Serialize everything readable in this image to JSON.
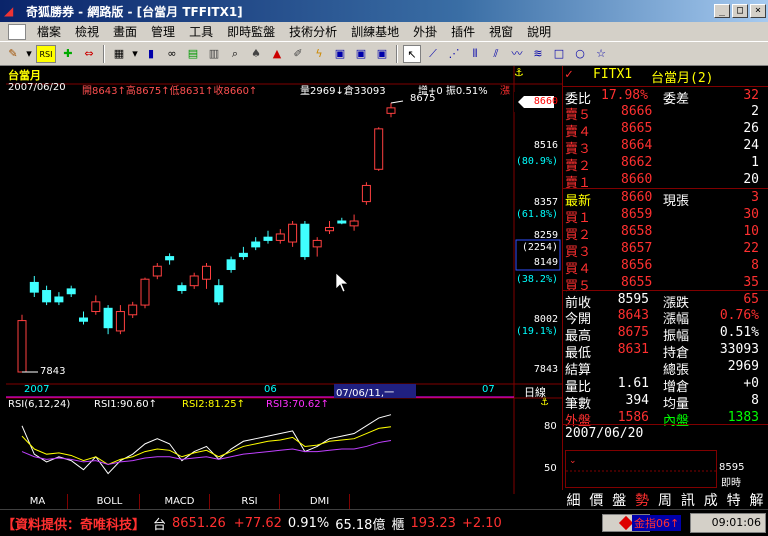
{
  "window": {
    "title": "奇狐勝券 - 網路版 - [台當月 TFFITX1]",
    "min": "_",
    "max": "□",
    "close": "×"
  },
  "menu": [
    "檔案",
    "檢視",
    "畫面",
    "管理",
    "工具",
    "即時監盤",
    "技術分析",
    "訓練基地",
    "外掛",
    "插件",
    "視窗",
    "說明"
  ],
  "toolbar": {
    "rsi_label": "RSI",
    "icons": [
      "arrow-icon",
      "cross-icon",
      "swap-icon",
      "grid-icon",
      "bar-icon",
      "link-icon",
      "book-icon",
      "search-icon",
      "hat-icon",
      "alarm-icon",
      "pen-icon",
      "flash-icon",
      "window-icon",
      "window2-icon",
      "window3-icon",
      "cursor-icon",
      "line-icon",
      "fan-icon",
      "lines-icon",
      "wave-icon",
      "wave2-icon",
      "box-icon",
      "circle-icon",
      "star-icon"
    ]
  },
  "chart": {
    "name": "台當月",
    "date": "2007/06/20",
    "ohlc": "開8643↑高8675↑低8631↑收8660↑",
    "vol": "量2969↓倉33093",
    "inc": "增+0 振0.51%",
    "rise": "漲",
    "high_label": "8675",
    "low_label": "7843",
    "price_scale": [
      "8660",
      "8516",
      "(80.9%)",
      "8357",
      "(61.8%)",
      "8259",
      "(2254)",
      "8149",
      "(38.2%)",
      "8002",
      "(19.1%)",
      "7843"
    ],
    "price_scale_colors": {
      "sel": "#ff0000",
      "fib": "#00ffff",
      "norm": "#ffffff",
      "blue": "#3050ff"
    },
    "xaxis": {
      "y2007": "2007",
      "m06": "06",
      "cursor": "07/06/11,一",
      "m07": "07",
      "daily": "日線"
    },
    "rsi_title": "RSI(6,12,24)",
    "rsi1": "RSI1:90.60↑",
    "rsi2": "RSI2:81.25↑",
    "rsi3": "RSI3:70.62↑",
    "rsi_scale": [
      "80",
      "50"
    ],
    "tabs": [
      "MA",
      "BOLL",
      "MACD",
      "RSI",
      "DMI"
    ]
  },
  "chart_data": {
    "type": "candlestick",
    "title": "台當月",
    "ylim": [
      7843,
      8675
    ],
    "candles": [
      {
        "o": 7843,
        "c": 8002,
        "h": 8020,
        "l": 7843,
        "up": true
      },
      {
        "o": 8120,
        "c": 8090,
        "h": 8140,
        "l": 8075,
        "up": false
      },
      {
        "o": 8095,
        "c": 8060,
        "h": 8110,
        "l": 8050,
        "up": false
      },
      {
        "o": 8075,
        "c": 8060,
        "h": 8090,
        "l": 8050,
        "up": false
      },
      {
        "o": 8100,
        "c": 8085,
        "h": 8110,
        "l": 8075,
        "up": false
      },
      {
        "o": 8010,
        "c": 8000,
        "h": 8030,
        "l": 7990,
        "up": false
      },
      {
        "o": 8030,
        "c": 8060,
        "h": 8080,
        "l": 8020,
        "up": true
      },
      {
        "o": 8040,
        "c": 7980,
        "h": 8050,
        "l": 7960,
        "up": false
      },
      {
        "o": 7970,
        "c": 8030,
        "h": 8050,
        "l": 7960,
        "up": true
      },
      {
        "o": 8020,
        "c": 8050,
        "h": 8060,
        "l": 8010,
        "up": true
      },
      {
        "o": 8050,
        "c": 8130,
        "h": 8135,
        "l": 8040,
        "up": true
      },
      {
        "o": 8140,
        "c": 8170,
        "h": 8180,
        "l": 8130,
        "up": true
      },
      {
        "o": 8200,
        "c": 8190,
        "h": 8210,
        "l": 8175,
        "up": false
      },
      {
        "o": 8110,
        "c": 8095,
        "h": 8120,
        "l": 8085,
        "up": false
      },
      {
        "o": 8110,
        "c": 8140,
        "h": 8150,
        "l": 8100,
        "up": true
      },
      {
        "o": 8170,
        "c": 8130,
        "h": 8180,
        "l": 8100,
        "up": true
      },
      {
        "o": 8110,
        "c": 8060,
        "h": 8130,
        "l": 8050,
        "up": false
      },
      {
        "o": 8190,
        "c": 8160,
        "h": 8200,
        "l": 8150,
        "up": false
      },
      {
        "o": 8210,
        "c": 8200,
        "h": 8230,
        "l": 8190,
        "up": false
      },
      {
        "o": 8245,
        "c": 8230,
        "h": 8260,
        "l": 8220,
        "up": false
      },
      {
        "o": 8260,
        "c": 8250,
        "h": 8280,
        "l": 8240,
        "up": false
      },
      {
        "o": 8250,
        "c": 8270,
        "h": 8285,
        "l": 8240,
        "up": true
      },
      {
        "o": 8245,
        "c": 8300,
        "h": 8310,
        "l": 8230,
        "up": true
      },
      {
        "o": 8300,
        "c": 8200,
        "h": 8310,
        "l": 8190,
        "up": false
      },
      {
        "o": 8230,
        "c": 8250,
        "h": 8260,
        "l": 8200,
        "up": true
      },
      {
        "o": 8280,
        "c": 8290,
        "h": 8310,
        "l": 8270,
        "up": true
      },
      {
        "o": 8310,
        "c": 8310,
        "h": 8320,
        "l": 8300,
        "up": false
      },
      {
        "o": 8295,
        "c": 8310,
        "h": 8330,
        "l": 8280,
        "up": true
      },
      {
        "o": 8370,
        "c": 8420,
        "h": 8430,
        "l": 8360,
        "up": true
      },
      {
        "o": 8470,
        "c": 8595,
        "h": 8600,
        "l": 8465,
        "up": true
      },
      {
        "o": 8643,
        "c": 8660,
        "h": 8675,
        "l": 8631,
        "up": true
      }
    ],
    "rsi": {
      "rsi1": [
        82,
        60,
        54,
        58,
        55,
        48,
        58,
        45,
        55,
        60,
        68,
        72,
        68,
        55,
        62,
        66,
        56,
        64,
        70,
        72,
        74,
        76,
        78,
        62,
        66,
        72,
        74,
        76,
        82,
        88,
        90.6
      ],
      "rsi2": [
        74,
        64,
        60,
        61,
        59,
        55,
        58,
        52,
        56,
        58,
        62,
        64,
        63,
        58,
        61,
        63,
        58,
        62,
        66,
        68,
        70,
        71,
        73,
        66,
        67,
        70,
        71,
        72,
        76,
        80,
        81.25
      ],
      "rsi3": [
        62,
        58,
        56,
        57,
        56,
        54,
        55,
        52,
        54,
        55,
        57,
        58,
        58,
        56,
        57,
        58,
        56,
        58,
        60,
        61,
        62,
        63,
        64,
        62,
        62,
        63,
        64,
        64,
        66,
        69,
        70.62
      ]
    }
  },
  "quote": {
    "symbol": "FITX1",
    "name": "台當月(2)",
    "check": "✓",
    "wb_label": "委比",
    "wb_val": "17.98%",
    "wc_label": "委差",
    "wc_val": "32",
    "asks": [
      {
        "l": "賣５",
        "p": "8666",
        "q": "2"
      },
      {
        "l": "賣４",
        "p": "8665",
        "q": "26"
      },
      {
        "l": "賣３",
        "p": "8664",
        "q": "24"
      },
      {
        "l": "賣２",
        "p": "8662",
        "q": "1"
      },
      {
        "l": "賣１",
        "p": "8660",
        "q": "20"
      }
    ],
    "last": {
      "l": "最新",
      "p": "8660",
      "cl": "現張",
      "q": "3"
    },
    "bids": [
      {
        "l": "買１",
        "p": "8659",
        "q": "30"
      },
      {
        "l": "買２",
        "p": "8658",
        "q": "10"
      },
      {
        "l": "買３",
        "p": "8657",
        "q": "22"
      },
      {
        "l": "買４",
        "p": "8656",
        "q": "8"
      },
      {
        "l": "買５",
        "p": "8655",
        "q": "35"
      }
    ],
    "stats": [
      {
        "a": "前收",
        "b": "8595",
        "c": "漲跌",
        "d": "65",
        "bc": "#ffffff",
        "dc": "#ff3030"
      },
      {
        "a": "今開",
        "b": "8643",
        "c": "漲幅",
        "d": "0.76%",
        "bc": "#ff3030",
        "dc": "#ff3030"
      },
      {
        "a": "最高",
        "b": "8675",
        "c": "振幅",
        "d": "0.51%",
        "bc": "#ff3030",
        "dc": "#ffffff"
      },
      {
        "a": "最低",
        "b": "8631",
        "c": "持倉",
        "d": "33093",
        "bc": "#ff3030",
        "dc": "#ffffff"
      },
      {
        "a": "結算",
        "b": "",
        "c": "總張",
        "d": "2969",
        "bc": "#ffffff",
        "dc": "#ffffff"
      },
      {
        "a": "量比",
        "b": "1.61",
        "c": "增倉",
        "d": "+0",
        "bc": "#ffffff",
        "dc": "#ffffff"
      },
      {
        "a": "筆數",
        "b": "394",
        "c": "均量",
        "d": "8",
        "bc": "#ffffff",
        "dc": "#ffffff"
      },
      {
        "a": "外盤",
        "b": "1586",
        "c": "內盤",
        "d": "1383",
        "bc": "#ff3030",
        "dc": "#00ff00"
      }
    ],
    "date": "2007/06/20",
    "mini_price": "8595",
    "mini_label": "即時",
    "tabs": [
      "細",
      "價",
      "盤",
      "勢",
      "周",
      "訊",
      "成",
      "特",
      "解"
    ]
  },
  "status": {
    "provider": "【資料提供：奇唯科技】",
    "index_name": "台",
    "index_val": "8651.26",
    "chg": "+77.62",
    "pct": "0.91%",
    "amt": "65.18億",
    "sub": "櫃",
    "sub_val": "193.23",
    "sub_chg": "+2.10",
    "ticker": "金指06↑",
    "time": "09:01:06"
  }
}
